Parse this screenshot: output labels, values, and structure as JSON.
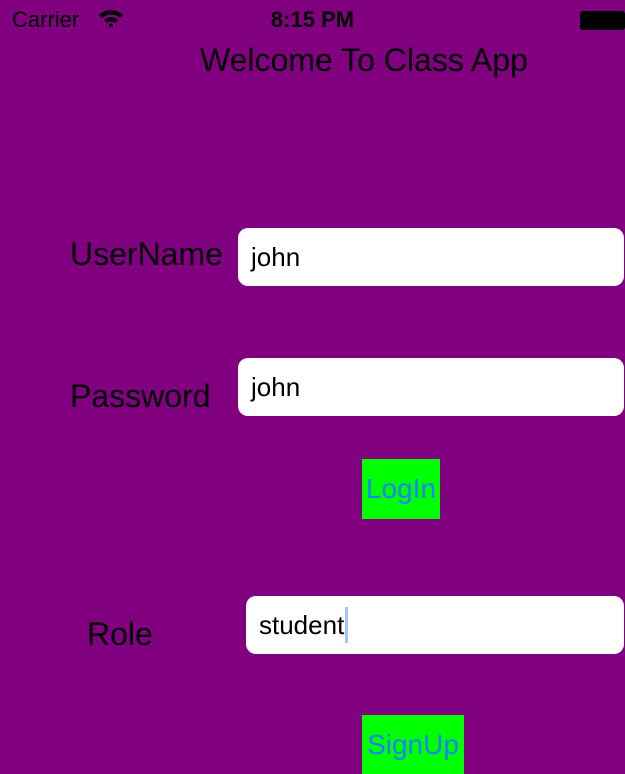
{
  "status_bar": {
    "carrier": "Carrier",
    "time": "8:15 PM",
    "wifi_icon": "wifi-icon",
    "battery_icon": "battery-icon"
  },
  "title": "Welcome To Class App",
  "form": {
    "username_label": "UserName",
    "username_value": "john",
    "password_label": "Password",
    "password_value": "john",
    "login_button": "LogIn",
    "role_label": "Role",
    "role_value": "student",
    "signup_button": "SignUp"
  },
  "colors": {
    "background": "#800080",
    "field_background": "#ffffff",
    "button_background": "#00ff00",
    "button_text": "#1e7fff",
    "caret": "#aac4f0"
  }
}
